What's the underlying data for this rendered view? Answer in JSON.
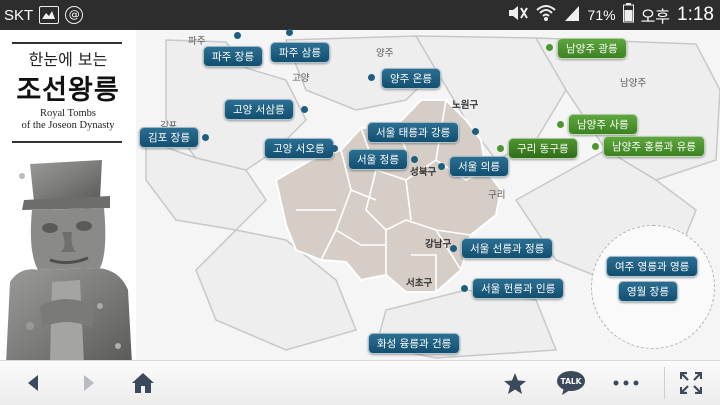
{
  "status_bar": {
    "carrier": "SKT",
    "battery": "71%",
    "ampm": "오후",
    "time": "1:18",
    "icons": [
      "gallery-icon",
      "talk-icon",
      "mute-icon",
      "wifi-icon",
      "signal-icon",
      "battery-icon"
    ]
  },
  "title": {
    "small": "한눈에 보는",
    "big": "조선왕릉",
    "en_line1": "Royal Tombs",
    "en_line2": "of the Joseon Dynasty"
  },
  "places": {
    "paju": "파주",
    "yangju": "양주",
    "goyang": "고양",
    "namyangju": "남양주",
    "nowon": "노원구",
    "gimpo": "김포",
    "seongbuk": "성북구",
    "guri": "구리",
    "gangnam": "강남구",
    "seocho": "서초구"
  },
  "tombs": {
    "paju_jang": "파주 장릉",
    "paju_sam": "파주 삼릉",
    "yangju_on": "양주 온릉",
    "namyangju_gwang": "남양주 광릉",
    "goyang_seosam": "고양 서삼릉",
    "gimpo_jang": "김포 장릉",
    "seoul_taegang": "서울 태릉과 강릉",
    "namyangju_sa": "남양주 사릉",
    "goyang_seoo": "고양 서오릉",
    "guri_donggu": "구리 동구릉",
    "namyangju_hongyu": "남양주 홍릉과 유릉",
    "seoul_jeong": "서울 정릉",
    "seoul_ui": "서울 의릉",
    "seoul_seonjeong": "서울 선릉과 정릉",
    "seoul_heonin": "서울 헌릉과 인릉",
    "hwaseong_yunggeon": "화성 융릉과 건릉",
    "yeoju_yeongnyeong": "여주 영릉과 영릉",
    "yeongwol_jang": "영월 장릉"
  },
  "bottom_bar": {
    "talk": "TALK",
    "icons": [
      "back-icon",
      "forward-icon",
      "home-icon",
      "star-icon",
      "talk-icon",
      "more-icon",
      "fullscreen-icon"
    ]
  },
  "colors": {
    "pin_blue": "#1d5d80",
    "pin_green": "#4c9630",
    "seoul_area": "#d5cdc5",
    "map_bg": "#f4f4f4"
  }
}
